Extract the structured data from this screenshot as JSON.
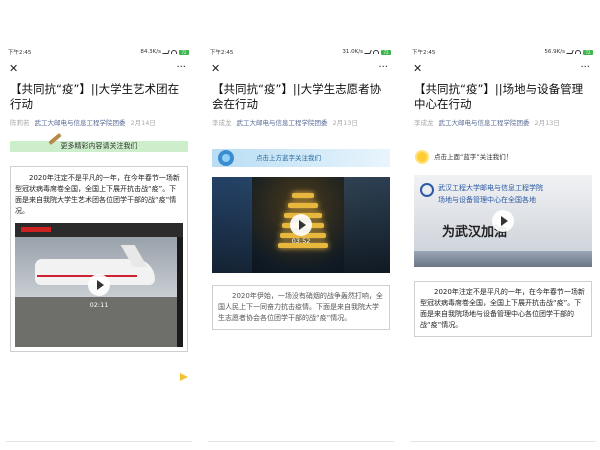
{
  "status": {
    "time": "下午2:45",
    "speed1": "84.3K/s",
    "speed2": "31.0K/s",
    "speed3": "56.9K/s",
    "battery": "72"
  },
  "nav": {
    "close": "✕",
    "more": "···"
  },
  "article1": {
    "title": "【共同抗“疫”】||大学生艺术团在行动",
    "author": "陈莉若",
    "account": "武工大邮电与信息工程学院团委",
    "date": "2月14日",
    "banner": "更多精彩内容请关注我们",
    "para1": "2020年注定不是平凡的一年，在今年春节一场新型冠状病毒席卷全国，全国上下展开抗击战“疫”。下面是来自我院大学生艺术团各位团学干部的战“疫”情况。",
    "video_duration": "02:11"
  },
  "article2": {
    "title": "【共同抗“疫”】||大学生志愿者协会在行动",
    "author": "李成龙",
    "account": "武工大邮电与信息工程学院团委",
    "date": "2月13日",
    "banner": "点击上方蓝字关注我们",
    "video_duration": "03:52",
    "para1": "2020年伊始，一场没有硝烟的战争轰然打响，全国人民上下一同奋力抗击疫情。下面是来自我院大学生志愿者协会各位团学干部的战“疫”情况。"
  },
  "article3": {
    "title": "【共同抗“疫”】||场地与设备管理中心在行动",
    "author": "李成龙",
    "account": "武工大邮电与信息工程学院团委",
    "date": "2月13日",
    "banner": "点击上面“蓝字”关注我们！",
    "video_line1": "武汉工程大学邮电与信息工程学院",
    "video_line2": "场地与设备管理中心在全国各地",
    "video_big": "为武汉加油",
    "para1": "2020年注定不是平凡的一年，在今年春节一场新型冠状病毒席卷全国，全国上下展开抗击战“疫”。下面是来自我院场地与设备管理中心各位团学干部的战“疫”情况。"
  }
}
